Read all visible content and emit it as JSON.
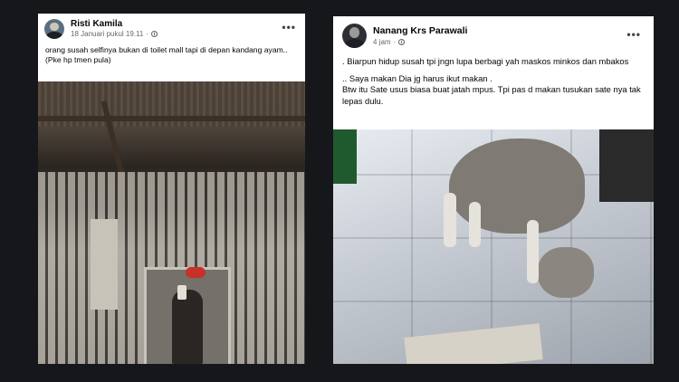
{
  "left_post": {
    "author": "Risti Kamila",
    "timestamp": "18 Januari pukul 19.11",
    "separator": "·",
    "more": "•••",
    "text_lines": [
      "orang susah selfinya bukan di toilet mall tapi di depan kandang ayam..",
      "(Pke hp tmen pula)"
    ]
  },
  "right_post": {
    "author": "Nanang Krs Parawali",
    "timestamp": "4 jam",
    "separator": "·",
    "more": "•••",
    "text_lines": [
      ". Biarpun hidup susah tpi jngn lupa berbagi yah maskos minkos dan mbakos",
      ".. Saya makan Dia jg harus ikut makan .",
      "Btw itu Sate usus biasa buat jatah mpus. Tpi pas d makan tusukan sate nya tak lepas dulu."
    ]
  }
}
